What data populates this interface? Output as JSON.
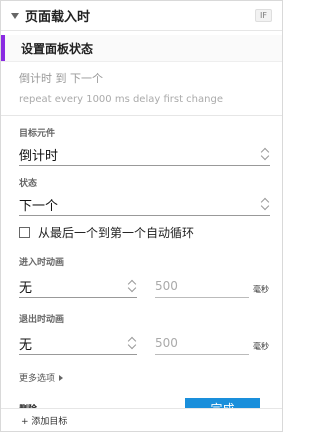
{
  "header": {
    "title": "页面载入时",
    "badge": "IF"
  },
  "action": {
    "label": "设置面板状态"
  },
  "summary": {
    "line1": "倒计时 到 下一个",
    "line2": "repeat every 1000 ms delay first change"
  },
  "form": {
    "target_label": "目标元件",
    "target_value": "倒计时",
    "state_label": "状态",
    "state_value": "下一个",
    "loop_checkbox_label": "从最后一个到第一个自动循环",
    "enter_anim_label": "进入时动画",
    "enter_anim_value": "无",
    "enter_duration_value": "500",
    "enter_unit": "毫秒",
    "exit_anim_label": "退出时动画",
    "exit_anim_value": "无",
    "exit_duration_value": "500",
    "exit_unit": "毫秒",
    "more_options": "更多选项"
  },
  "buttons": {
    "delete": "删除",
    "done": "完成",
    "add_target": "+ 添加目标"
  },
  "colors": {
    "accent": "#8a2be2",
    "primary": "#1a8fdb"
  }
}
